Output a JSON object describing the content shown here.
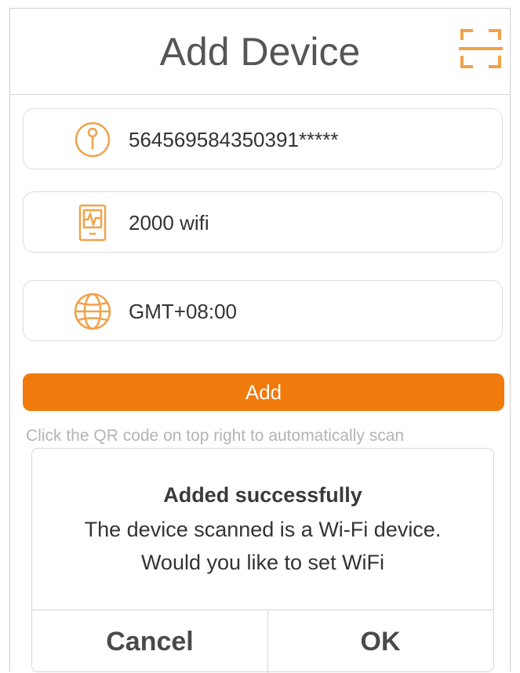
{
  "header": {
    "title": "Add Device",
    "scan_icon": "qr-scan-icon"
  },
  "fields": {
    "serial": {
      "icon": "key-icon",
      "value": "564569584350391*****"
    },
    "model": {
      "icon": "device-icon",
      "value": "2000 wifi"
    },
    "timezone": {
      "icon": "globe-icon",
      "value": "GMT+08:00"
    }
  },
  "add_button": {
    "label": "Add"
  },
  "hint": "Click the QR code on top right to automatically scan",
  "dialog": {
    "title": "Added successfully",
    "message_line1": "The device scanned is a Wi-Fi device.",
    "message_line2": "Would you like to set WiFi",
    "cancel_label": "Cancel",
    "ok_label": "OK"
  },
  "colors": {
    "accent": "#f07a0c",
    "icon": "#f0a24a",
    "text": "#333333"
  }
}
